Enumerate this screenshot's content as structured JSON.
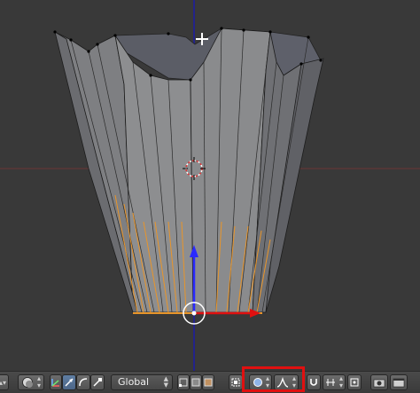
{
  "viewport": {
    "object": "mesh",
    "axis_colors": {
      "x": "#9a3030",
      "z": "#2020c0",
      "manipulator_y": "#2a2aff",
      "manipulator_x": "#e01010"
    },
    "selection_color": "#f0a030",
    "icons": [
      "3d-cursor-icon",
      "mouse-cursor-icon",
      "manipulator-widget"
    ]
  },
  "header": {
    "editor_type_icon": "3d-view-icon",
    "viewport_shading_icon": "shading-sphere-icon",
    "pivot_icon": "pivot-icon",
    "manipulator_icons": [
      "manipulator-toggle-icon",
      "translate-icon",
      "rotate-icon",
      "scale-icon"
    ],
    "orientation": {
      "value": "Global",
      "options": [
        "Global"
      ]
    },
    "select_mode_icons": [
      "vertex-select-icon",
      "edge-select-icon",
      "face-select-icon"
    ],
    "occlude_icon": "occlude-geometry-icon",
    "proportional_icon": "proportional-editing-icon",
    "proportional_falloff_icon": "falloff-smooth-icon",
    "snap_icon": "magnet-icon",
    "snap_element_icon": "snap-increment-icon",
    "extra_icons": [
      "snap-target-icon",
      "render-icon",
      "anim-render-icon"
    ],
    "highlight_color": "#e01010"
  }
}
